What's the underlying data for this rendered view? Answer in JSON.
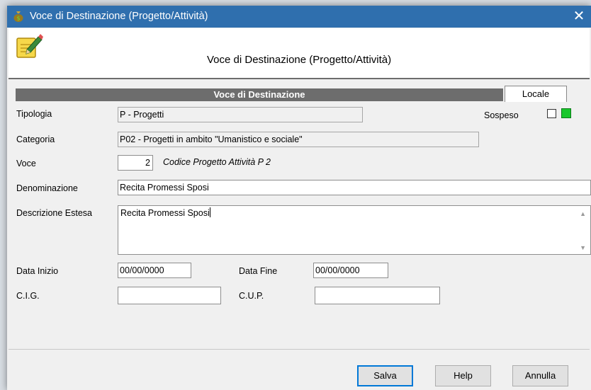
{
  "window": {
    "title": "Voce di Destinazione (Progetto/Attività)",
    "close_glyph": "✕"
  },
  "header": {
    "title": "Voce di Destinazione (Progetto/Attività)",
    "icon": "form-edit-icon"
  },
  "section": {
    "title": "Voce di Destinazione",
    "tab_label": "Locale"
  },
  "form": {
    "tipologia": {
      "label": "Tipologia",
      "value": "P - Progetti"
    },
    "sospeso": {
      "label": "Sospeso",
      "checked": false,
      "status_color": "#19c72c"
    },
    "categoria": {
      "label": "Categoria",
      "value": "P02 - Progetti in ambito \"Umanistico e sociale\""
    },
    "voce": {
      "label": "Voce",
      "value": "2",
      "note": "Codice Progetto Attività P 2"
    },
    "denominazione": {
      "label": "Denominazione",
      "value": "Recita Promessi Sposi"
    },
    "descrizione": {
      "label": "Descrizione Estesa",
      "value": "Recita Promessi Sposi"
    },
    "data_inizio": {
      "label": "Data Inizio",
      "value": "00/00/0000"
    },
    "data_fine": {
      "label": "Data Fine",
      "value": "00/00/0000"
    },
    "cig": {
      "label": "C.I.G.",
      "value": ""
    },
    "cup": {
      "label": "C.U.P.",
      "value": ""
    }
  },
  "buttons": {
    "save": "Salva",
    "help": "Help",
    "cancel": "Annulla"
  },
  "colors": {
    "titlebar": "#2f6fae",
    "section_bar": "#6d6d6d",
    "default_button_border": "#0078d7"
  }
}
